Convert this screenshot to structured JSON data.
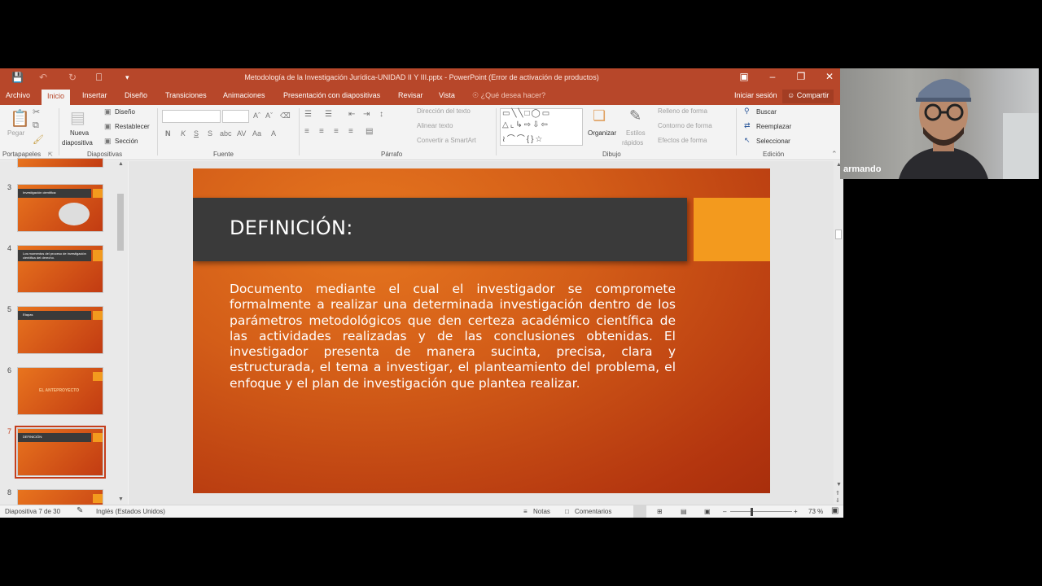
{
  "window": {
    "title": "Metodología de la Investigación Jurídica-UNIDAD II Y III.pptx - PowerPoint (Error de activación de productos)"
  },
  "tabs": [
    "Archivo",
    "Inicio",
    "Insertar",
    "Diseño",
    "Transiciones",
    "Animaciones",
    "Presentación con diapositivas",
    "Revisar",
    "Vista"
  ],
  "tell_me": "¿Qué desea hacer?",
  "account": {
    "signin": "Iniciar sesión",
    "share": "Compartir"
  },
  "ribbon": {
    "portapapeles": {
      "paste": "Pegar",
      "group": "Portapapeles"
    },
    "diapositivas": {
      "new_slide_1": "Nueva",
      "new_slide_2": "diapositiva",
      "layout": "Diseño",
      "reset": "Restablecer",
      "section": "Sección",
      "group": "Diapositivas"
    },
    "fuente": {
      "group": "Fuente"
    },
    "parrafo": {
      "text_direction": "Dirección del texto",
      "align_text": "Alinear texto",
      "smartart": "Convertir a SmartArt",
      "group": "Párrafo"
    },
    "dibujo": {
      "arrange": "Organizar",
      "quick_styles_1": "Estilos",
      "quick_styles_2": "rápidos",
      "fill": "Relleno de forma",
      "outline": "Contorno de forma",
      "effects": "Efectos de forma",
      "group": "Dibujo"
    },
    "edicion": {
      "find": "Buscar",
      "replace": "Reemplazar",
      "select": "Seleccionar",
      "group": "Edición"
    }
  },
  "thumbnails": [
    {
      "num": "3",
      "title": "Investigación científica:"
    },
    {
      "num": "4",
      "title": "Los momentos del proceso de investigación científica del derecho."
    },
    {
      "num": "5",
      "title": "Etapas"
    },
    {
      "num": "6",
      "title": "EL ANTEPROYECTO"
    },
    {
      "num": "7",
      "title": "DEFINICIÓN:"
    },
    {
      "num": "8",
      "title": ""
    }
  ],
  "slide": {
    "heading": "DEFINICIÓN:",
    "body": "Documento mediante el cual el investigador se compromete formalmente a realizar una determinada investigación dentro de los parámetros metodológicos que den certeza académico científica de las actividades realizadas y de las conclusiones obtenidas. El investigador presenta de manera sucinta, precisa, clara y estructurada, el tema a investigar, el planteamiento del problema, el enfoque y el plan de investigación que plantea realizar."
  },
  "status": {
    "slide_info": "Diapositiva 7 de 30",
    "language": "Inglés (Estados Unidos)",
    "notes": "Notas",
    "comments": "Comentarios",
    "zoom": "73 %"
  },
  "webcam": {
    "name": "armando"
  },
  "colors": {
    "accent": "#b7472a",
    "slide_orange": "#d35d18",
    "header_dark": "#3a3a3a",
    "accent_orange": "#f39a1e"
  }
}
